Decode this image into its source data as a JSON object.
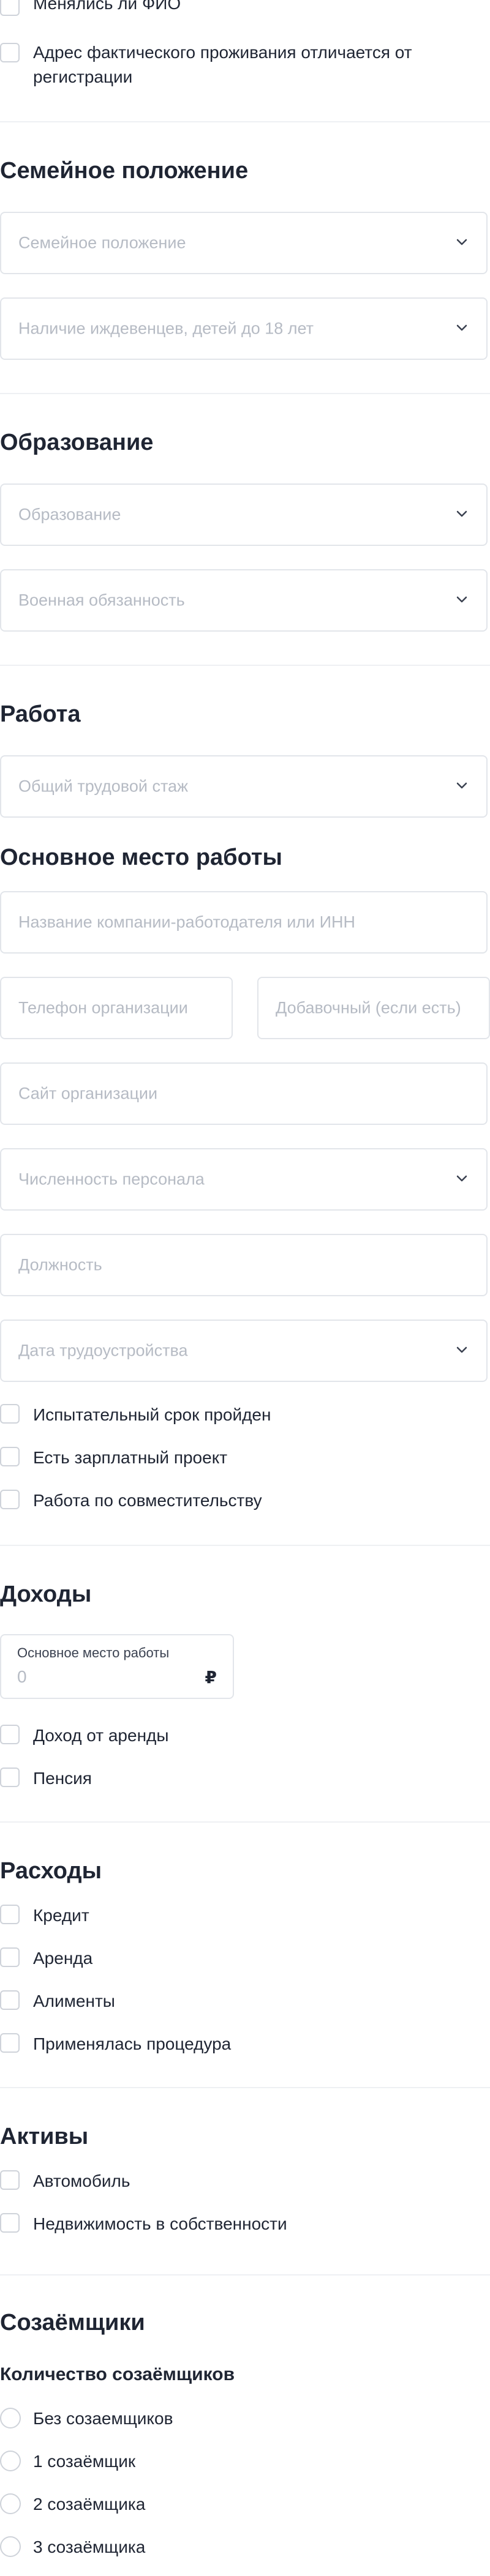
{
  "personal": {
    "name_changed_label": "Менялись ли ФИО",
    "address_differs_label": "Адрес фактического проживания отличается от регистрации"
  },
  "family": {
    "title": "Семейное положение",
    "marital_status_placeholder": "Семейное положение",
    "dependents_placeholder": "Наличие иждевенцев, детей до 18 лет"
  },
  "education": {
    "title": "Образование",
    "education_placeholder": "Образование",
    "military_placeholder": "Военная обязанность"
  },
  "work": {
    "title": "Работа",
    "experience_placeholder": "Общий трудовой стаж"
  },
  "main_job": {
    "title": "Основное место работы",
    "company_placeholder": "Название компании-работодателя или ИНН",
    "phone_placeholder": "Телефон организации",
    "extension_placeholder": "Добавочный (если есть)",
    "website_placeholder": "Сайт организации",
    "staff_count_placeholder": "Численность персонала",
    "position_placeholder": "Должность",
    "hire_date_placeholder": "Дата трудоустройства",
    "probation_label": "Испытательный срок пройден",
    "salary_project_label": "Есть зарплатный проект",
    "part_time_label": "Работа по совместительству"
  },
  "income": {
    "title": "Доходы",
    "main_job_label": "Основное место работы",
    "main_job_value": "0",
    "currency": "₽",
    "rent_label": "Доход от аренды",
    "pension_label": "Пенсия"
  },
  "expenses": {
    "title": "Расходы",
    "credit_label": "Кредит",
    "rent_label": "Аренда",
    "alimony_label": "Алименты",
    "procedure_label": "Применялась процедура"
  },
  "assets": {
    "title": "Активы",
    "car_label": "Автомобиль",
    "property_label": "Недвижимость в собственности"
  },
  "co_borrowers": {
    "title": "Созаёмщики",
    "count_title": "Количество созаёмщиков",
    "options": [
      "Без созаемщиков",
      "1 созаёмщик",
      "2 созаёмщика",
      "3 созаёмщика"
    ]
  },
  "colors": {
    "text": "#1f2533",
    "placeholder": "#b6bbc4",
    "border": "#e2e5ea",
    "divider": "#eef0f3"
  }
}
